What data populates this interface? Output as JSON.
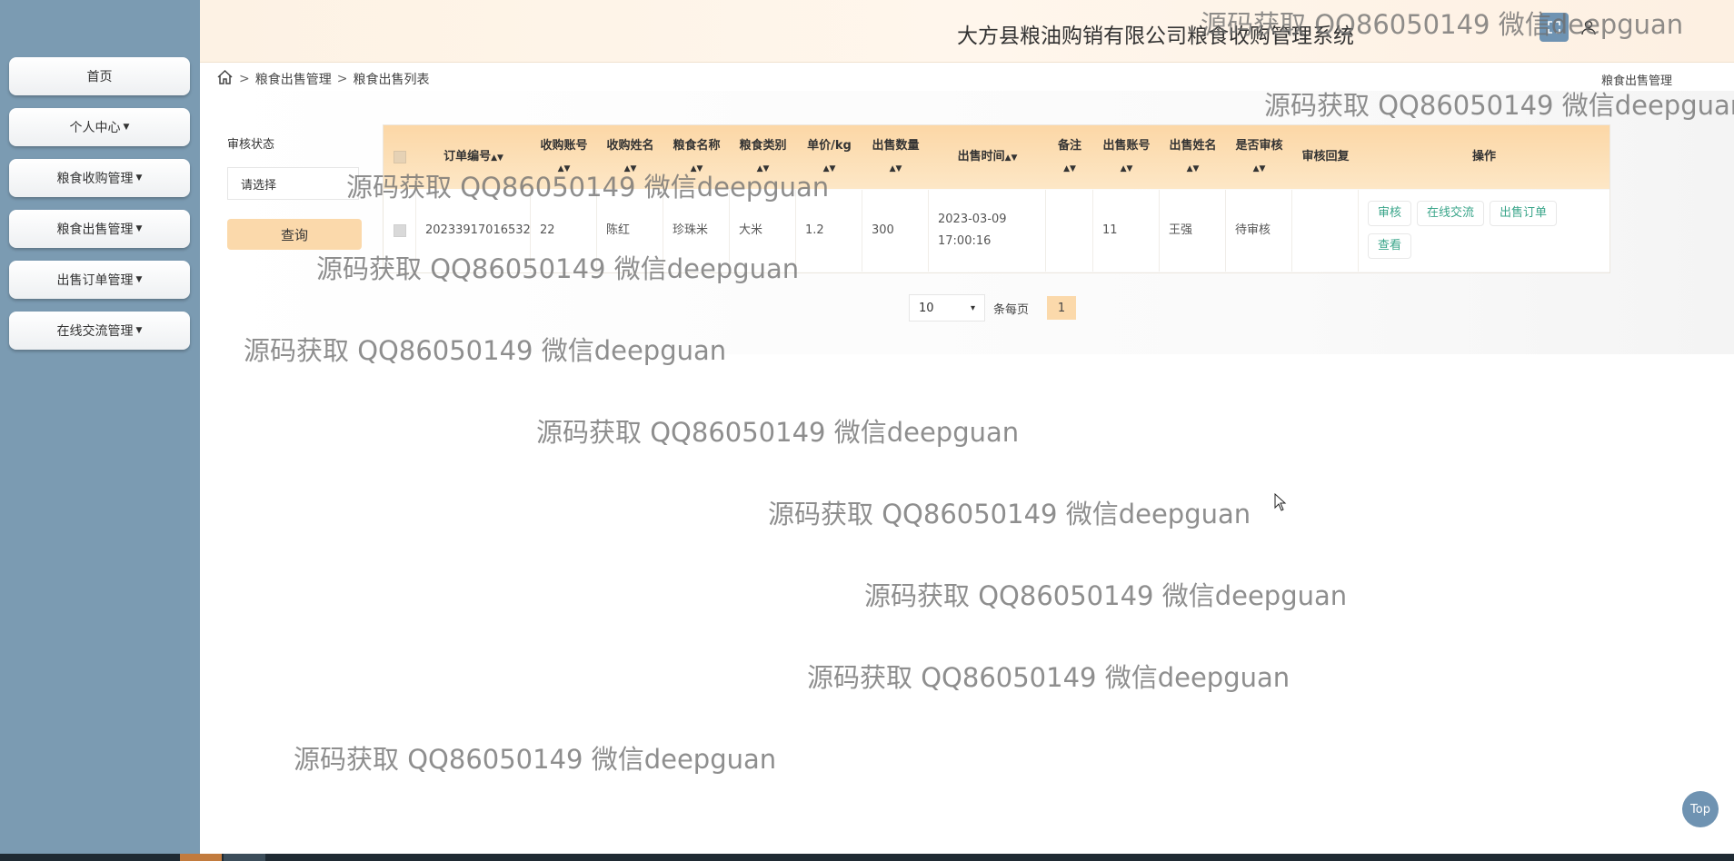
{
  "header": {
    "title": "大方县粮油购销有限公司粮食收购管理系统"
  },
  "sidebar": {
    "items": [
      {
        "label": "首页",
        "caret": false
      },
      {
        "label": "个人中心",
        "caret": true
      },
      {
        "label": "粮食收购管理",
        "caret": true
      },
      {
        "label": "粮食出售管理",
        "caret": true
      },
      {
        "label": "出售订单管理",
        "caret": true
      },
      {
        "label": "在线交流管理",
        "caret": true
      }
    ]
  },
  "breadcrumb": {
    "level1": "粮食出售管理",
    "level2": "粮食出售列表",
    "right": "粮食出售管理"
  },
  "filter": {
    "label": "审核状态",
    "select_value": "请选择",
    "query_label": "查询"
  },
  "table": {
    "headers": [
      "订单编号",
      "收购账号",
      "收购姓名",
      "粮食名称",
      "粮食类别",
      "单价/kg",
      "出售数量",
      "出售时间",
      "备注",
      "出售账号",
      "出售姓名",
      "是否审核",
      "审核回复",
      "操作"
    ],
    "row": {
      "order_no": "20233917016532",
      "buyer_account": "22",
      "buyer_name": "陈红",
      "grain_name": "珍珠米",
      "grain_type": "大米",
      "unit_price": "1.2",
      "quantity": "300",
      "sale_date": "2023-03-09",
      "sale_time": "17:00:16",
      "remark": "",
      "seller_account": "11",
      "seller_name": "王强",
      "audit_status": "待审核",
      "audit_reply": ""
    },
    "actions": [
      "审核",
      "在线交流",
      "出售订单",
      "查看"
    ]
  },
  "pagination": {
    "page_size": "10",
    "per_page_label": "条每页",
    "current_page": "1"
  },
  "watermark": {
    "text": "源码获取 QQ86050149 微信deepguan"
  },
  "top_button": {
    "label": "Top"
  },
  "colors": {
    "sidebar": "#7b9bb2",
    "accent": "#fbd9ab",
    "action_text": "#3aa58a"
  }
}
